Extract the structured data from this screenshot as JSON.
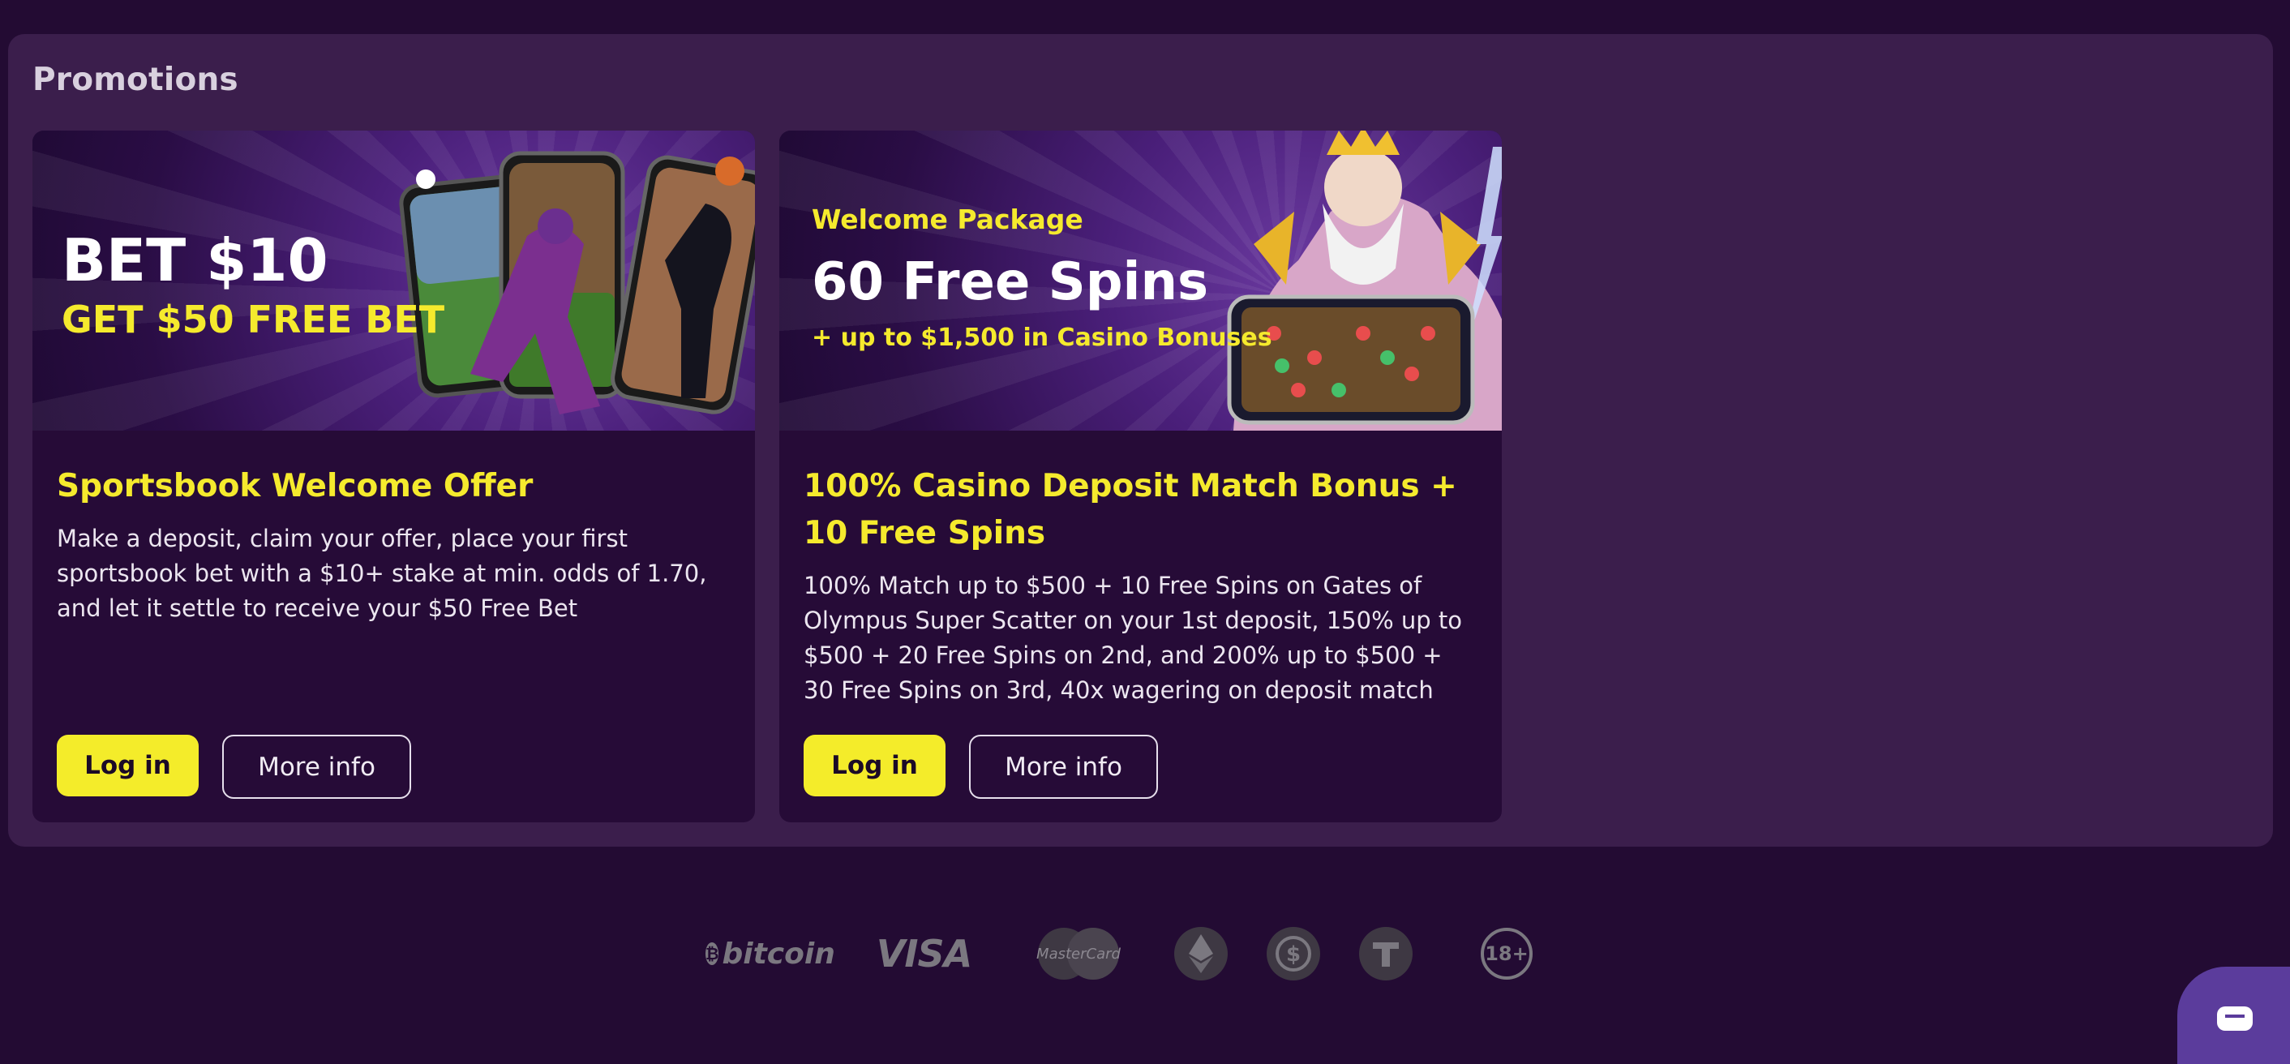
{
  "section_title": "Promotions",
  "cards": [
    {
      "banner": {
        "line1": "BET $10",
        "line2": "GET $50 FREE BET"
      },
      "title": "Sportsbook Welcome Offer",
      "description": "Make a deposit, claim your offer, place your first sportsbook bet with a $10+ stake at min. odds of 1.70, and let it settle to receive your $50 Free Bet",
      "login_label": "Log in",
      "more_label": "More info"
    },
    {
      "banner": {
        "line1": "Welcome Package",
        "line2": "60 Free Spins",
        "line3": "+ up to $1,500 in Casino Bonuses"
      },
      "title": "100% Casino Deposit Match Bonus + 10 Free Spins",
      "description": "100% Match up to $500 + 10 Free Spins on Gates of Olympus Super Scatter on your 1st deposit, 150% up to $500 + 20 Free Spins on 2nd, and 200% up to $500 + 30 Free Spins on 3rd, 40x wagering on deposit match",
      "login_label": "Log in",
      "more_label": "More info"
    }
  ],
  "footer": {
    "bitcoin_label": "bitcoin",
    "visa_label": "VISA",
    "mastercard_label": "MasterCard",
    "age_label": "18+"
  },
  "colors": {
    "accent": "#f4ec2a",
    "background": "#230b33",
    "panel": "#3b1e4c",
    "card": "#260b37"
  }
}
